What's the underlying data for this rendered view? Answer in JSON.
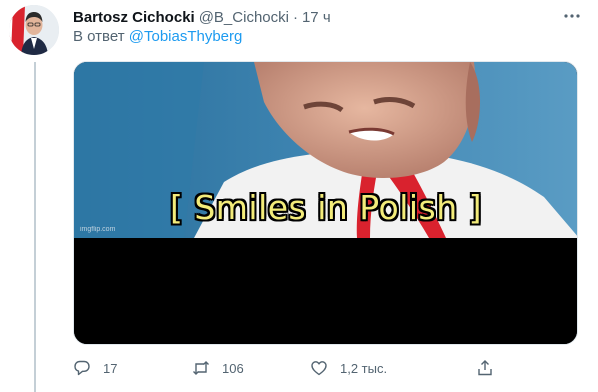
{
  "tweet": {
    "author_name": "Bartosz Cichocki",
    "author_handle": "@B_Cichocki",
    "separator": "·",
    "time": "17 ч",
    "reply_prefix": "В ответ",
    "reply_to": "@TobiasThyberg",
    "media": {
      "caption": "[ Smiles in Polish  ]",
      "watermark": "imgflip.com"
    },
    "actions": {
      "reply_count": "17",
      "retweet_count": "106",
      "like_count": "1,2 тыс."
    }
  },
  "icons": {
    "more": "more-horizontal-icon",
    "reply": "reply-bubble-icon",
    "retweet": "retweet-icon",
    "like": "heart-icon",
    "share": "share-icon"
  },
  "colors": {
    "link": "#1d9bf0",
    "secondary_text": "#536471",
    "caption": "#f3ec7a",
    "thread_line": "#c4cfd6"
  }
}
